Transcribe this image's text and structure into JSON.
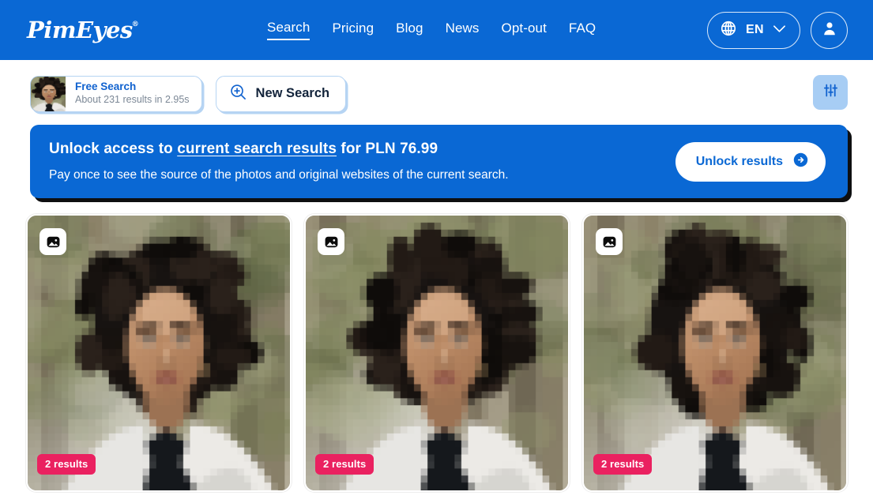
{
  "brand": {
    "logo_text": "PimEyes",
    "registered_mark": "®",
    "primary_color": "#0A68D4",
    "accent_pink": "#EA2160",
    "chip_border": "#B6D4F3"
  },
  "header": {
    "nav": [
      {
        "label": "Search",
        "active": true,
        "name": "nav-search"
      },
      {
        "label": "Pricing",
        "active": false,
        "name": "nav-pricing"
      },
      {
        "label": "Blog",
        "active": false,
        "name": "nav-blog"
      },
      {
        "label": "News",
        "active": false,
        "name": "nav-news"
      },
      {
        "label": "Opt-out",
        "active": false,
        "name": "nav-opt-out"
      },
      {
        "label": "FAQ",
        "active": false,
        "name": "nav-faq"
      }
    ],
    "language": {
      "code": "EN",
      "globe_icon": "globe-icon",
      "chevron_icon": "chevron-down-icon"
    },
    "account_icon": "user-avatar-icon"
  },
  "search_bar": {
    "free_search_title": "Free Search",
    "free_search_subtitle": "About 231 results in 2.95s",
    "results_count": 231,
    "elapsed_seconds": "2.95s",
    "thumbnail_icon": "face-thumbnail",
    "new_search_label": "New Search",
    "new_search_icon": "zoom-in-icon",
    "filter_icon": "sliders-filter-icon"
  },
  "banner": {
    "title_prefix": "Unlock access to ",
    "title_link": "current search results",
    "title_suffix": " for PLN 76.99",
    "price": "PLN 76.99",
    "subtitle": "Pay once to see the source of the photos and original websites of the current search.",
    "cta_label": "Unlock results",
    "cta_icon": "arrow-right-circle-icon"
  },
  "results": [
    {
      "badge": "2 results",
      "count": 2,
      "image_icon": "photo-icon",
      "alt": "pixelated portrait of a woman with curly dark hair in a white hoodie"
    },
    {
      "badge": "2 results",
      "count": 2,
      "image_icon": "photo-icon",
      "alt": "pixelated portrait of a woman with curly dark hair in a white hoodie"
    },
    {
      "badge": "2 results",
      "count": 2,
      "image_icon": "photo-icon",
      "alt": "pixelated portrait of a woman with curly dark hair in a white hoodie"
    }
  ]
}
